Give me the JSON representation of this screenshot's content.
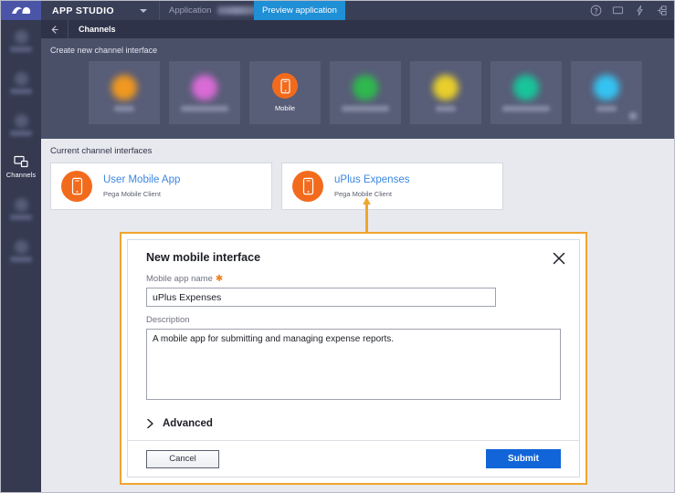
{
  "topbar": {
    "logo_name": "pega-logo-icon",
    "studio_label": "APP STUDIO",
    "application_label": "Application",
    "application_value": "",
    "preview_button": "Preview application",
    "icons": [
      "help-icon",
      "screen-icon",
      "lightning-icon",
      "node-icon"
    ]
  },
  "subheader": {
    "back": "back-arrow-icon",
    "title": "Channels"
  },
  "rail": {
    "items": [
      {
        "label": "",
        "blurred": true
      },
      {
        "label": "",
        "blurred": true
      },
      {
        "label": "",
        "blurred": true
      },
      {
        "label": "Channels",
        "blurred": false,
        "active": true
      },
      {
        "label": "",
        "blurred": true
      },
      {
        "label": "",
        "blurred": true
      }
    ]
  },
  "create_panel": {
    "title": "Create new channel interface",
    "tiles": [
      {
        "label": "",
        "color": "#f0981f",
        "blurred": true,
        "width": "narrow"
      },
      {
        "label": "",
        "color": "#da6bd6",
        "blurred": true,
        "width": "wide"
      },
      {
        "label": "Mobile",
        "color": "#f26b1d",
        "blurred": false,
        "width": ""
      },
      {
        "label": "",
        "color": "#2eb84e",
        "blurred": true,
        "width": "wide"
      },
      {
        "label": "",
        "color": "#e8cf2a",
        "blurred": true,
        "width": "narrow"
      },
      {
        "label": "",
        "color": "#18c49a",
        "blurred": true,
        "width": "wide"
      },
      {
        "label": "",
        "color": "#34c3f2",
        "blurred": true,
        "width": "narrow"
      }
    ]
  },
  "current_panel": {
    "title": "Current channel interfaces",
    "cards": [
      {
        "title": "User Mobile App",
        "subtitle": "Pega Mobile Client"
      },
      {
        "title": "uPlus Expenses",
        "subtitle": "Pega Mobile Client"
      }
    ]
  },
  "modal": {
    "title": "New mobile interface",
    "close": "close-icon",
    "name_label": "Mobile app name",
    "name_required_mark": "✱",
    "name_value": "uPlus Expenses",
    "name_placeholder": "",
    "description_label": "Description",
    "description_value": "A mobile app for submitting and managing expense reports.",
    "description_placeholder": "",
    "advanced_label": "Advanced",
    "cancel_label": "Cancel",
    "submit_label": "Submit"
  },
  "colors": {
    "accent_orange": "#f0a52e",
    "brand_orange": "#f26b1d",
    "link_blue": "#3b87e0",
    "submit_blue": "#1265d8",
    "preview_blue": "#1f8fd6",
    "dark_chrome": "#3a3f58",
    "rail": "#353a51",
    "panel": "#4b5069",
    "content_bg": "#e8e9ee"
  }
}
